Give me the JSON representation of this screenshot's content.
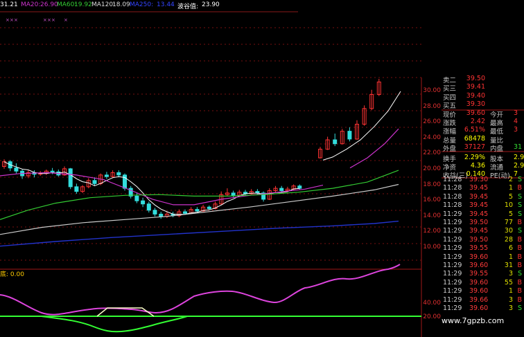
{
  "topbar": {
    "ma_prefix_value": "31.21",
    "ma20_label": "MA20:",
    "ma20_value": "26.90",
    "ma60_label": "MA60:",
    "ma60_value": "19.92",
    "ma120_label": "MA120:",
    "ma120_value": "18.09",
    "ma250_label": "MA250:",
    "ma250_value": "13.44",
    "bolu_label": "波谷值:",
    "bolu_value": "23.90"
  },
  "colors": {
    "ma_short": "#ffffff",
    "ma20": "#cc33cc",
    "ma60": "#33cc33",
    "ma120": "#cccccc",
    "ma250": "#2233cc",
    "up": "#ff3333",
    "down": "#33dddd",
    "indicator_main": "#dd44dd",
    "indicator_base": "#33ff33",
    "indicator_wave": "#ffffcc"
  },
  "price_axis": [
    "30.00",
    "28.00",
    "26.00",
    "24.00",
    "22.00",
    "20.00",
    "18.00",
    "16.00",
    "14.00",
    "12.00",
    "10.00"
  ],
  "indicator_axis": [
    "40.00",
    "20.00"
  ],
  "indicator_label": "底: 0.00",
  "quote_panel": {
    "rows": [
      {
        "label": "卖二",
        "value": "39.50",
        "label2": "",
        "value2": ""
      },
      {
        "label": "买三",
        "value": "39.41",
        "label2": "",
        "value2": ""
      },
      {
        "label": "买四",
        "value": "39.40",
        "label2": "",
        "value2": ""
      },
      {
        "label": "买五",
        "value": "39.30",
        "label2": "",
        "value2": ""
      },
      {
        "label": "现价",
        "value": "39.60",
        "label2": "今开",
        "value2": "3"
      },
      {
        "label": "涨跌",
        "value": "2.42",
        "label2": "最高",
        "value2": "4"
      },
      {
        "label": "涨幅",
        "value": "6.51%",
        "label2": "最低",
        "value2": "3"
      },
      {
        "label": "总量",
        "value": "68478",
        "label2": "量比",
        "value2": ""
      },
      {
        "label": "外盘",
        "value": "37127",
        "label2": "内盘",
        "value2": "31"
      },
      {
        "label": "换手",
        "value": "2.29%",
        "label2": "股本",
        "value2": "2.9"
      },
      {
        "label": "净资",
        "value": "4.36",
        "label2": "流通",
        "value2": "2.9"
      },
      {
        "label": "收益(三)",
        "value": "0.140",
        "label2": "PE(动)",
        "value2": "7"
      }
    ]
  },
  "trades": [
    {
      "time": "11:28",
      "price": "39.30",
      "qty": "2",
      "side": "S"
    },
    {
      "time": "11:28",
      "price": "39.45",
      "qty": "1",
      "side": "B"
    },
    {
      "time": "11:28",
      "price": "39.45",
      "qty": "5",
      "side": "S"
    },
    {
      "time": "11:28",
      "price": "39.45",
      "qty": "10",
      "side": "S"
    },
    {
      "time": "11:29",
      "price": "39.45",
      "qty": "5",
      "side": "S"
    },
    {
      "time": "11:29",
      "price": "39.50",
      "qty": "77",
      "side": "B"
    },
    {
      "time": "11:29",
      "price": "39.45",
      "qty": "30",
      "side": "S"
    },
    {
      "time": "11:29",
      "price": "39.50",
      "qty": "28",
      "side": "B"
    },
    {
      "time": "11:29",
      "price": "39.55",
      "qty": "6",
      "side": "B"
    },
    {
      "time": "11:29",
      "price": "39.60",
      "qty": "1",
      "side": "B"
    },
    {
      "time": "11:29",
      "price": "39.60",
      "qty": "31",
      "side": "B"
    },
    {
      "time": "11:29",
      "price": "39.55",
      "qty": "3",
      "side": "S"
    },
    {
      "time": "11:29",
      "price": "39.60",
      "qty": "55",
      "side": "B"
    },
    {
      "time": "11:29",
      "price": "39.60",
      "qty": "1",
      "side": "B"
    },
    {
      "time": "11:29",
      "price": "39.66",
      "qty": "3",
      "side": "B"
    },
    {
      "time": "11:29",
      "price": "39.60",
      "qty": "3",
      "side": "S"
    }
  ],
  "watermark": "www.7gpzb.com",
  "candles": [
    {
      "o": 20.4,
      "c": 21.0,
      "h": 21.3,
      "l": 20.1
    },
    {
      "o": 21.0,
      "c": 20.2,
      "h": 21.2,
      "l": 19.8
    },
    {
      "o": 20.2,
      "c": 19.8,
      "h": 20.8,
      "l": 19.5
    },
    {
      "o": 19.8,
      "c": 19.2,
      "h": 20.0,
      "l": 18.8
    },
    {
      "o": 19.2,
      "c": 19.6,
      "h": 19.9,
      "l": 18.9
    },
    {
      "o": 19.6,
      "c": 19.4,
      "h": 19.9,
      "l": 19.0
    },
    {
      "o": 19.4,
      "c": 19.5,
      "h": 19.8,
      "l": 19.2
    },
    {
      "o": 19.5,
      "c": 19.8,
      "h": 20.0,
      "l": 19.3
    },
    {
      "o": 19.8,
      "c": 19.7,
      "h": 20.2,
      "l": 19.4
    },
    {
      "o": 19.7,
      "c": 19.3,
      "h": 20.0,
      "l": 19.1
    },
    {
      "o": 19.3,
      "c": 20.1,
      "h": 20.4,
      "l": 19.2
    },
    {
      "o": 20.1,
      "c": 17.8,
      "h": 20.2,
      "l": 17.5
    },
    {
      "o": 17.8,
      "c": 17.2,
      "h": 18.2,
      "l": 16.9
    },
    {
      "o": 17.2,
      "c": 17.8,
      "h": 18.0,
      "l": 17.0
    },
    {
      "o": 17.8,
      "c": 18.6,
      "h": 18.9,
      "l": 17.6
    },
    {
      "o": 18.6,
      "c": 18.2,
      "h": 19.0,
      "l": 17.9
    },
    {
      "o": 18.2,
      "c": 19.3,
      "h": 19.5,
      "l": 18.0
    },
    {
      "o": 19.3,
      "c": 19.1,
      "h": 19.7,
      "l": 18.8
    },
    {
      "o": 19.1,
      "c": 19.6,
      "h": 19.9,
      "l": 18.9
    },
    {
      "o": 19.6,
      "c": 19.3,
      "h": 19.9,
      "l": 19.0
    },
    {
      "o": 19.3,
      "c": 17.6,
      "h": 19.5,
      "l": 17.3
    },
    {
      "o": 17.6,
      "c": 16.6,
      "h": 17.9,
      "l": 16.3
    },
    {
      "o": 16.6,
      "c": 16.0,
      "h": 17.0,
      "l": 15.7
    },
    {
      "o": 16.0,
      "c": 15.6,
      "h": 16.4,
      "l": 15.2
    },
    {
      "o": 15.6,
      "c": 14.8,
      "h": 15.9,
      "l": 14.5
    },
    {
      "o": 14.8,
      "c": 14.3,
      "h": 15.1,
      "l": 14.0
    },
    {
      "o": 14.3,
      "c": 14.0,
      "h": 14.6,
      "l": 13.7
    },
    {
      "o": 14.0,
      "c": 14.3,
      "h": 14.6,
      "l": 13.8
    },
    {
      "o": 14.3,
      "c": 14.1,
      "h": 14.6,
      "l": 13.9
    },
    {
      "o": 14.1,
      "c": 14.6,
      "h": 14.9,
      "l": 13.9
    },
    {
      "o": 14.6,
      "c": 14.4,
      "h": 14.9,
      "l": 14.2
    },
    {
      "o": 14.4,
      "c": 14.9,
      "h": 15.2,
      "l": 14.3
    },
    {
      "o": 14.9,
      "c": 14.7,
      "h": 15.2,
      "l": 14.5
    },
    {
      "o": 14.7,
      "c": 15.2,
      "h": 15.5,
      "l": 14.6
    },
    {
      "o": 15.2,
      "c": 15.0,
      "h": 15.4,
      "l": 14.8
    },
    {
      "o": 15.0,
      "c": 15.6,
      "h": 15.9,
      "l": 14.9
    },
    {
      "o": 15.6,
      "c": 16.8,
      "h": 17.2,
      "l": 15.5
    },
    {
      "o": 16.8,
      "c": 17.0,
      "h": 17.6,
      "l": 16.6
    },
    {
      "o": 17.0,
      "c": 16.7,
      "h": 17.3,
      "l": 16.4
    },
    {
      "o": 16.7,
      "c": 17.1,
      "h": 17.4,
      "l": 16.5
    },
    {
      "o": 17.1,
      "c": 16.9,
      "h": 17.4,
      "l": 16.7
    },
    {
      "o": 16.9,
      "c": 17.2,
      "h": 17.5,
      "l": 16.8
    },
    {
      "o": 17.2,
      "c": 17.0,
      "h": 17.5,
      "l": 16.8
    },
    {
      "o": 17.0,
      "c": 16.2,
      "h": 17.2,
      "l": 15.9
    },
    {
      "o": 16.2,
      "c": 17.3,
      "h": 17.6,
      "l": 16.1
    },
    {
      "o": 17.3,
      "c": 17.6,
      "h": 17.9,
      "l": 17.1
    },
    {
      "o": 17.6,
      "c": 17.3,
      "h": 17.9,
      "l": 17.1
    },
    {
      "o": 17.3,
      "c": 17.5,
      "h": 17.8,
      "l": 17.2
    },
    {
      "o": 17.5,
      "c": 17.9,
      "h": 18.1,
      "l": 17.3
    },
    {
      "o": 17.9,
      "c": 17.6,
      "h": 18.1,
      "l": 17.4
    },
    {
      "o": 21.5,
      "c": 22.6,
      "h": 22.9,
      "l": 21.4
    },
    {
      "o": 22.6,
      "c": 23.8,
      "h": 24.2,
      "l": 22.5
    },
    {
      "o": 23.8,
      "c": 23.3,
      "h": 24.6,
      "l": 23.0
    },
    {
      "o": 23.3,
      "c": 24.9,
      "h": 25.2,
      "l": 23.2
    },
    {
      "o": 24.9,
      "c": 23.9,
      "h": 25.4,
      "l": 23.6
    },
    {
      "o": 23.9,
      "c": 25.8,
      "h": 26.3,
      "l": 23.8
    },
    {
      "o": 25.8,
      "c": 27.8,
      "h": 28.2,
      "l": 25.6
    },
    {
      "o": 27.8,
      "c": 29.6,
      "h": 30.2,
      "l": 27.6
    },
    {
      "o": 29.6,
      "c": 31.2,
      "h": 31.6,
      "l": 29.4
    }
  ]
}
